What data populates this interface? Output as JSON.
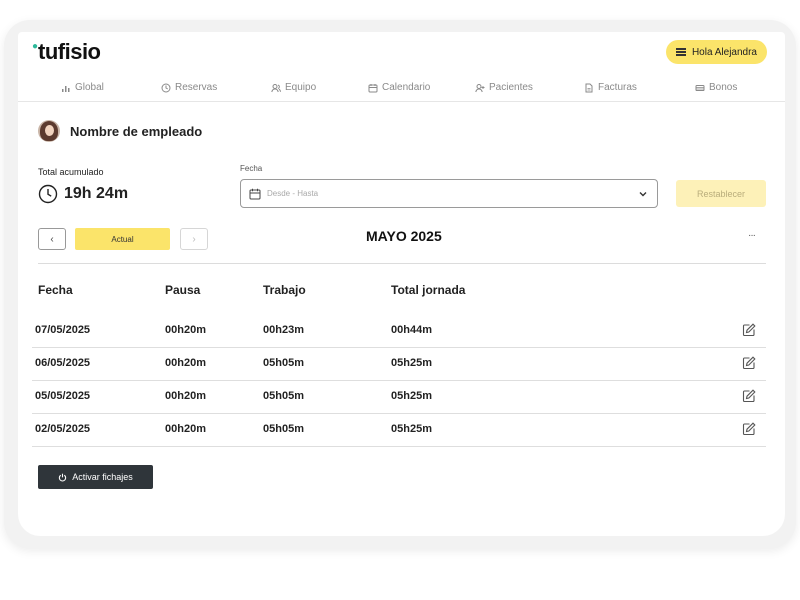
{
  "app": {
    "logo": "tufisio"
  },
  "header": {
    "greeting": "Hola Alejandra"
  },
  "nav": {
    "items": [
      {
        "label": "Global",
        "icon": "bar-chart-icon"
      },
      {
        "label": "Reservas",
        "icon": "clock-icon"
      },
      {
        "label": "Equipo",
        "icon": "users-icon"
      },
      {
        "label": "Calendario",
        "icon": "calendar-icon"
      },
      {
        "label": "Pacientes",
        "icon": "user-plus-icon"
      },
      {
        "label": "Facturas",
        "icon": "document-icon"
      },
      {
        "label": "Bonos",
        "icon": "ticket-icon"
      }
    ]
  },
  "employee": {
    "name": "Nombre de empleado"
  },
  "summary": {
    "total_label": "Total acumulado",
    "total_value": "19h 24m"
  },
  "filter": {
    "date_label": "Fecha",
    "date_placeholder": "Desde - Hasta",
    "reset_label": "Restablecer"
  },
  "period": {
    "prev_label": "‹",
    "current_label": "Actual",
    "next_label": "›",
    "month_title": "MAYO 2025",
    "more_label": "···"
  },
  "table": {
    "headers": [
      "Fecha",
      "Pausa",
      "Trabajo",
      "Total jornada"
    ],
    "rows": [
      [
        "07/05/2025",
        "00h20m",
        "00h23m",
        "00h44m"
      ],
      [
        "06/05/2025",
        "00h20m",
        "05h05m",
        "05h25m"
      ],
      [
        "05/05/2025",
        "00h20m",
        "05h05m",
        "05h25m"
      ],
      [
        "02/05/2025",
        "00h20m",
        "05h05m",
        "05h25m"
      ]
    ]
  },
  "actions": {
    "activate_label": "Activar fichajes"
  },
  "colors": {
    "accent": "#fbe46a",
    "dark_button": "#2f353a",
    "logo_dot": "#2db99a"
  }
}
